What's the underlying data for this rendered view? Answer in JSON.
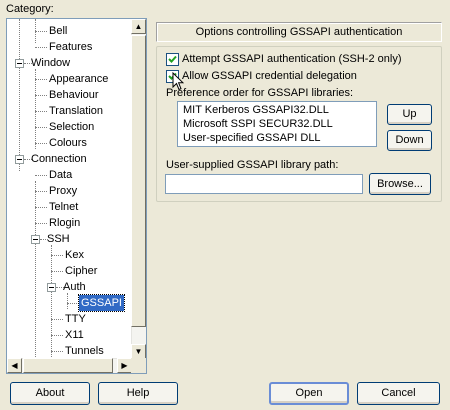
{
  "category_label": "Category:",
  "tree": {
    "items": [
      {
        "label": "Bell"
      },
      {
        "label": "Features"
      },
      {
        "label": "Window"
      },
      {
        "label": "Appearance"
      },
      {
        "label": "Behaviour"
      },
      {
        "label": "Translation"
      },
      {
        "label": "Selection"
      },
      {
        "label": "Colours"
      },
      {
        "label": "Connection"
      },
      {
        "label": "Data"
      },
      {
        "label": "Proxy"
      },
      {
        "label": "Telnet"
      },
      {
        "label": "Rlogin"
      },
      {
        "label": "SSH"
      },
      {
        "label": "Kex"
      },
      {
        "label": "Cipher"
      },
      {
        "label": "Auth"
      },
      {
        "label": "GSSAPI"
      },
      {
        "label": "TTY"
      },
      {
        "label": "X11"
      },
      {
        "label": "Tunnels"
      }
    ],
    "selected": "GSSAPI"
  },
  "panel": {
    "title": "Options controlling GSSAPI authentication",
    "attempt_gssapi": {
      "label": "Attempt GSSAPI authentication (SSH-2 only)",
      "checked": true
    },
    "allow_delegation": {
      "label": "Allow GSSAPI credential delegation",
      "checked": true
    },
    "preference_label": "Preference order for GSSAPI libraries:",
    "libraries": [
      "MIT Kerberos GSSAPI32.DLL",
      "Microsoft SSPI SECUR32.DLL",
      "User-specified GSSAPI DLL"
    ],
    "up_label": "Up",
    "down_label": "Down",
    "library_path_label": "User-supplied GSSAPI library path:",
    "library_path_value": "",
    "browse_label": "Browse..."
  },
  "footer": {
    "about_label": "About",
    "help_label": "Help",
    "open_label": "Open",
    "cancel_label": "Cancel"
  },
  "icons": {
    "scroll_up": "▲",
    "scroll_down": "▼",
    "scroll_left": "◀",
    "scroll_right": "▶"
  }
}
